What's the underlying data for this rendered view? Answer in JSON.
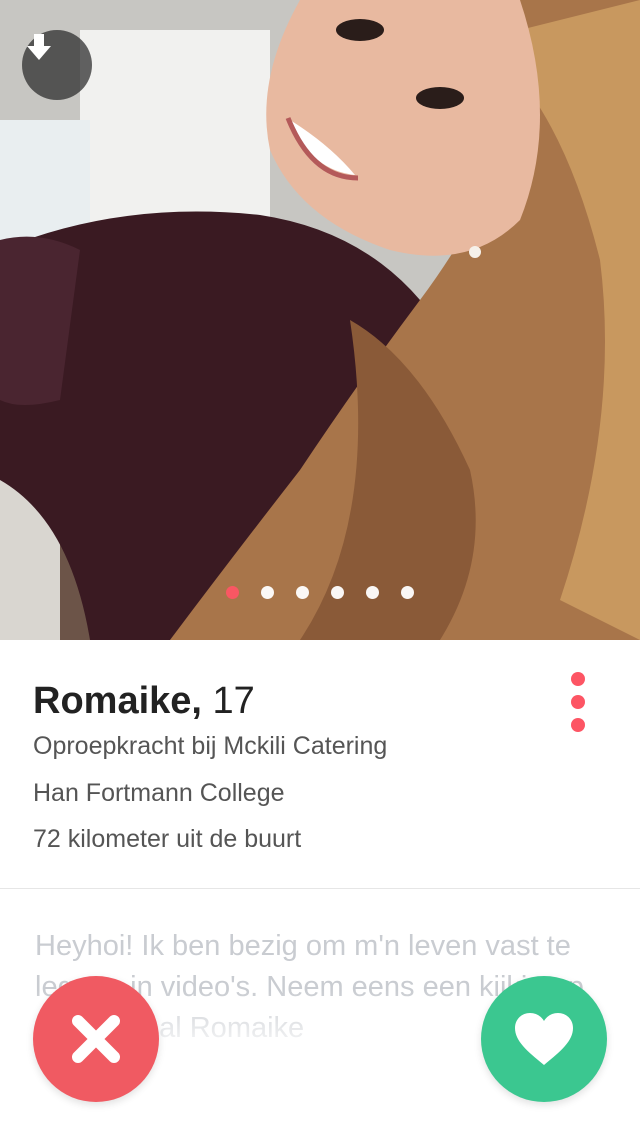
{
  "photo": {
    "current_index": 1,
    "total": 6,
    "accent_color": "#fd5564"
  },
  "profile": {
    "name": "Romaike,",
    "age": "17",
    "job": "Oproepkracht bij Mckili Catering",
    "school": "Han Fortmann College",
    "distance": "72 kilometer uit de buurt",
    "bio": "Heyhoi! Ik ben bezig om m'n leven vast te leggen in video's. Neem eens een kijkje op mijn kanaal Romaike"
  },
  "icons": {
    "back": "arrow-down-icon",
    "more": "more-vertical-icon",
    "nope": "close-icon",
    "like": "heart-icon"
  },
  "colors": {
    "nope": "#f05a62",
    "like": "#3bc790",
    "dot_active": "#fd5564"
  }
}
